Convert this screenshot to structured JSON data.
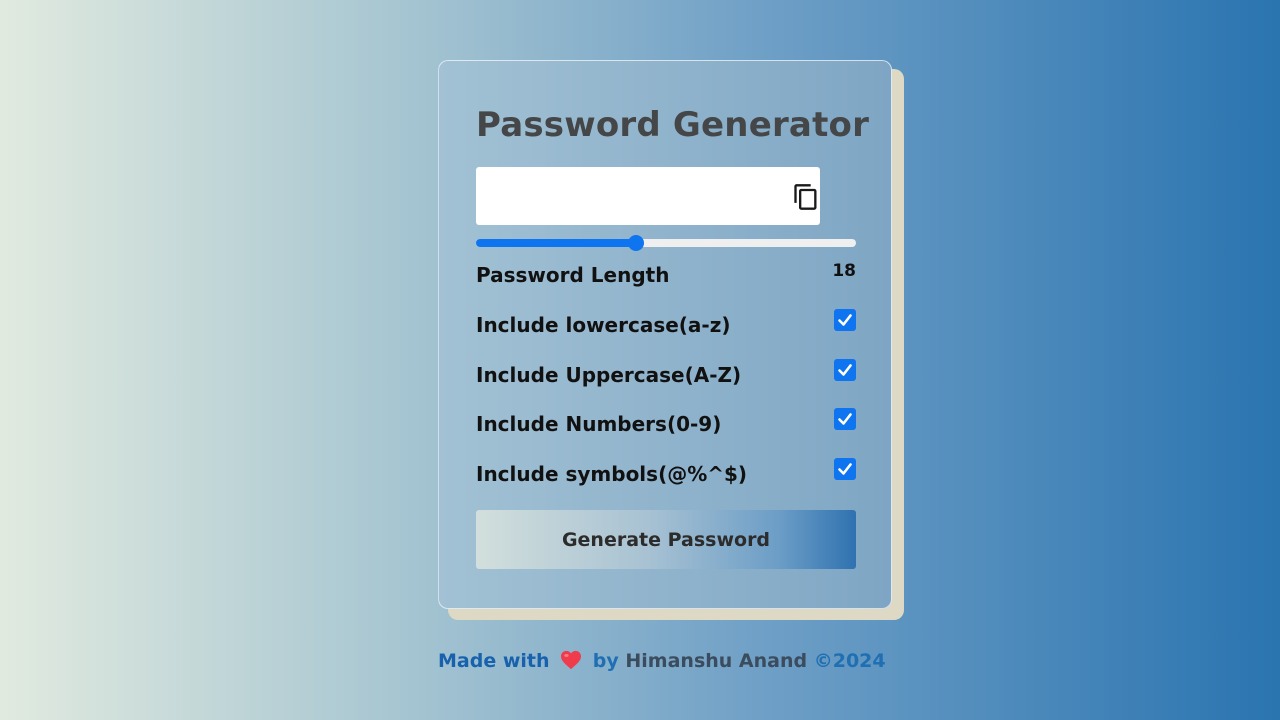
{
  "app": {
    "title": "Password Generator"
  },
  "password": {
    "value": "",
    "placeholder": ""
  },
  "length": {
    "label": "Password Length",
    "value": "18",
    "slider_fraction": 0.42
  },
  "options": [
    {
      "label": "Include lowercase(a-z)",
      "checked": true
    },
    {
      "label": "Include Uppercase(A-Z)",
      "checked": true
    },
    {
      "label": "Include Numbers(0-9)",
      "checked": true
    },
    {
      "label": "Include symbols(@%^$)",
      "checked": true
    }
  ],
  "generate_label": "Generate Password",
  "footer": {
    "made_with": "Made with",
    "by": "by",
    "author": "Himanshu Anand",
    "copyright": "©2024"
  },
  "icons": {
    "copy": "copy-icon",
    "heart": "heart-icon",
    "check": "checkmark-icon"
  },
  "colors": {
    "accent": "#0f74f0",
    "title": "#444647",
    "footer_blue": "#1862ad"
  }
}
